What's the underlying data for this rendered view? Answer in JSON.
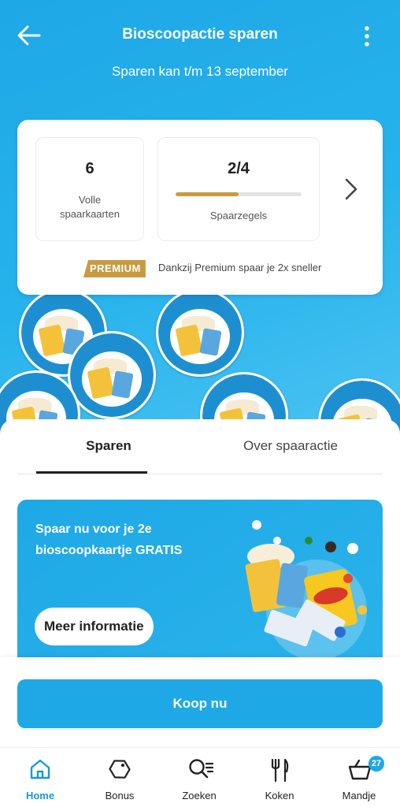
{
  "header": {
    "title": "Bioscoopactie sparen",
    "subtitle": "Sparen kan t/m 13 september"
  },
  "summary": {
    "cards_count": "6",
    "cards_label": "Volle spaarkaarten",
    "stamps_value": "2/4",
    "stamps_progress": 0.5,
    "stamps_label": "Spaarzegels",
    "premium_badge": "PREMIUM",
    "premium_text": "Dankzij Premium spaar je 2x sneller"
  },
  "stamp_label": "Bioscoopzegel",
  "tabs": [
    {
      "label": "Sparen",
      "active": true
    },
    {
      "label": "Over spaaractie",
      "active": false
    }
  ],
  "promo": {
    "text": "Spaar nu voor je 2e bioscoopkaartje GRATIS",
    "button": "Meer informatie"
  },
  "cta": {
    "label": "Koop nu"
  },
  "nav": {
    "items": [
      {
        "label": "Home",
        "icon": "home-icon",
        "active": true
      },
      {
        "label": "Bonus",
        "icon": "bonus-tag-icon"
      },
      {
        "label": "Zoeken",
        "icon": "search-icon"
      },
      {
        "label": "Koken",
        "icon": "cutlery-icon"
      },
      {
        "label": "Mandje",
        "icon": "basket-icon"
      }
    ],
    "basket_count": "27"
  },
  "colors": {
    "brand_blue": "#1ea8e6",
    "premium_gold": "#c99a3f",
    "white": "#ffffff"
  }
}
